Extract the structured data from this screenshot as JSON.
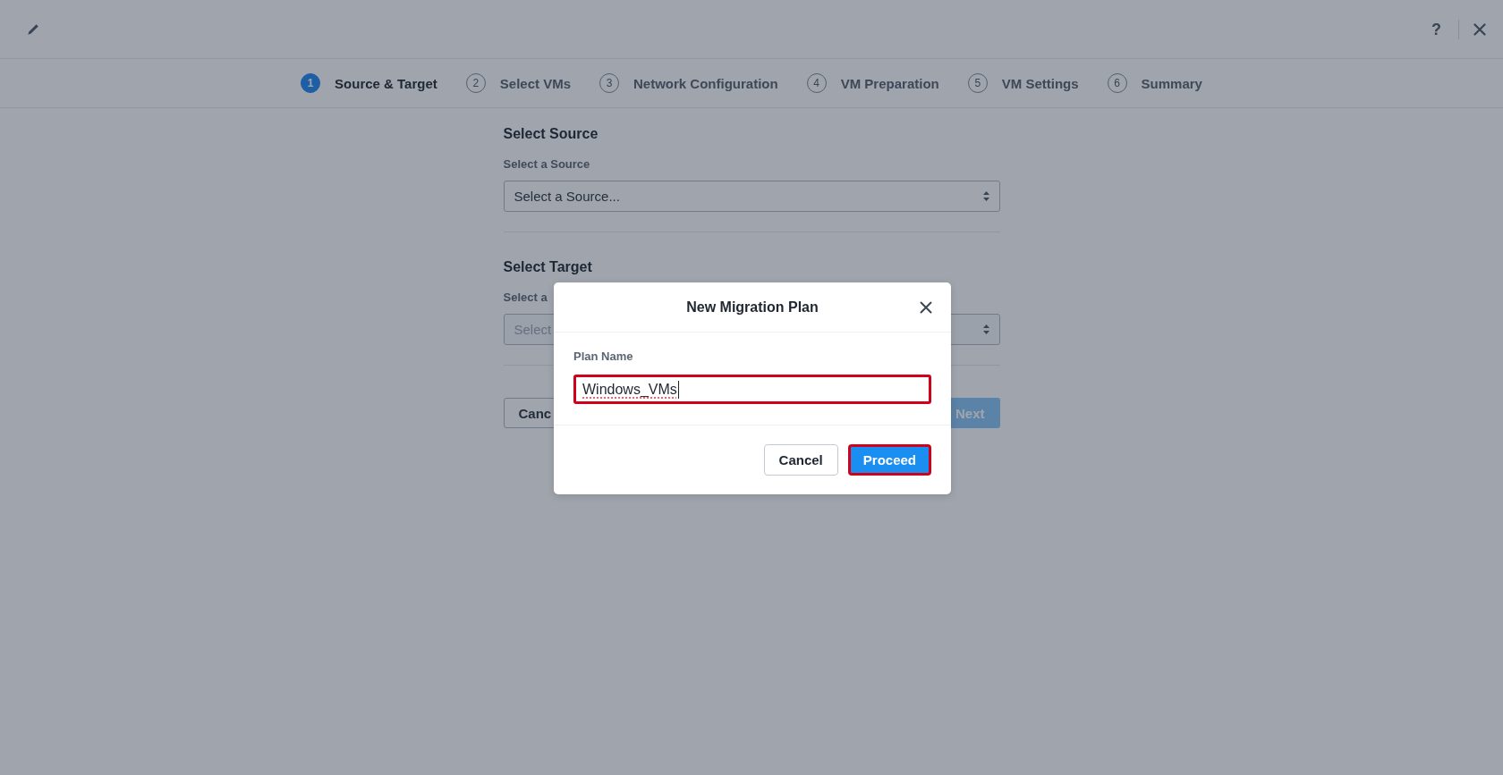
{
  "toolbar": {
    "help_label": "?"
  },
  "steps": [
    {
      "number": "1",
      "label": "Source & Target",
      "selected": true
    },
    {
      "number": "2",
      "label": "Select VMs",
      "selected": false
    },
    {
      "number": "3",
      "label": "Network Configuration",
      "selected": false
    },
    {
      "number": "4",
      "label": "VM Preparation",
      "selected": false
    },
    {
      "number": "5",
      "label": "VM Settings",
      "selected": false
    },
    {
      "number": "6",
      "label": "Summary",
      "selected": false
    }
  ],
  "form": {
    "sections": [
      {
        "heading": "Select Source",
        "label": "Select a Source",
        "placeholder": "Select a Source...",
        "disabled": false
      },
      {
        "heading": "Select Target",
        "label": "Select a",
        "placeholder": "Select",
        "disabled": true
      }
    ],
    "cancel_label": "Canc",
    "next": {
      "label": "Next",
      "disabled": true
    }
  },
  "dialog": {
    "title": "New Migration Plan",
    "field": {
      "label": "Plan Name",
      "value": "Windows_VMs",
      "highlighted": true
    },
    "buttons": [
      {
        "label": "Cancel",
        "kind": "secondary",
        "highlighted": false
      },
      {
        "label": "Proceed",
        "kind": "primary",
        "highlighted": true
      }
    ]
  }
}
